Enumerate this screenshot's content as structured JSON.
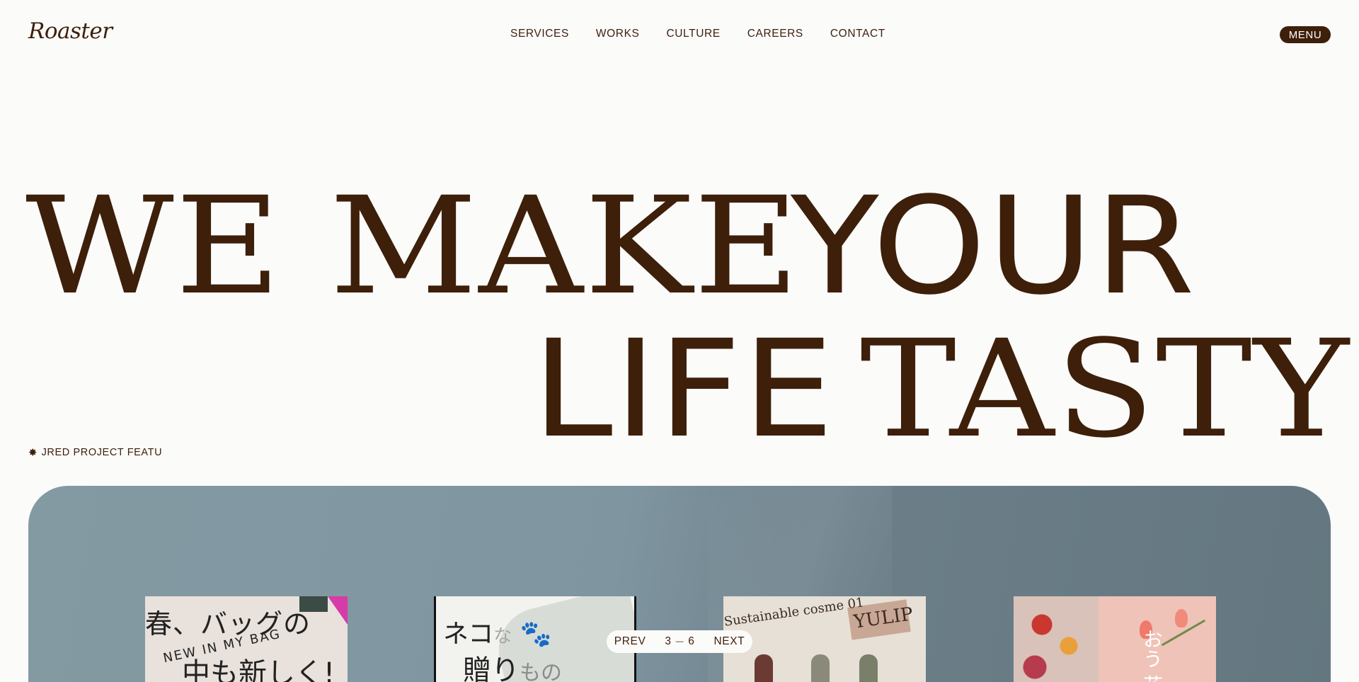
{
  "header": {
    "logo": "Roaster",
    "nav": [
      "SERVICES",
      "WORKS",
      "CULTURE",
      "CAREERS",
      "CONTACT"
    ],
    "menu_label": "MENU"
  },
  "hero": {
    "line1a": "WE MAKE",
    "line1b": "YOUR",
    "line2a": "LIFE",
    "line2b": "TASTY"
  },
  "ticker": {
    "text": "JRED PROJECT   FEATU"
  },
  "showcase": {
    "cards": [
      {
        "text1": "春、バッグの",
        "text2": "NEW IN MY BAG",
        "text3": "中も新しく!"
      },
      {
        "text1a": "ネコ",
        "text1b": "な",
        "text2a": "贈り",
        "text2b": "もの"
      },
      {
        "label": "Sustainable cosme 01",
        "brand": "YULIP"
      },
      {
        "text": "おう 花"
      }
    ]
  },
  "pager": {
    "prev": "PREV",
    "current": "3",
    "separator": "—",
    "total": "6",
    "next": "NEXT"
  },
  "colors": {
    "brand": "#3d1f0a",
    "background": "#fbfbfa",
    "showcase": "#7f95a0"
  }
}
